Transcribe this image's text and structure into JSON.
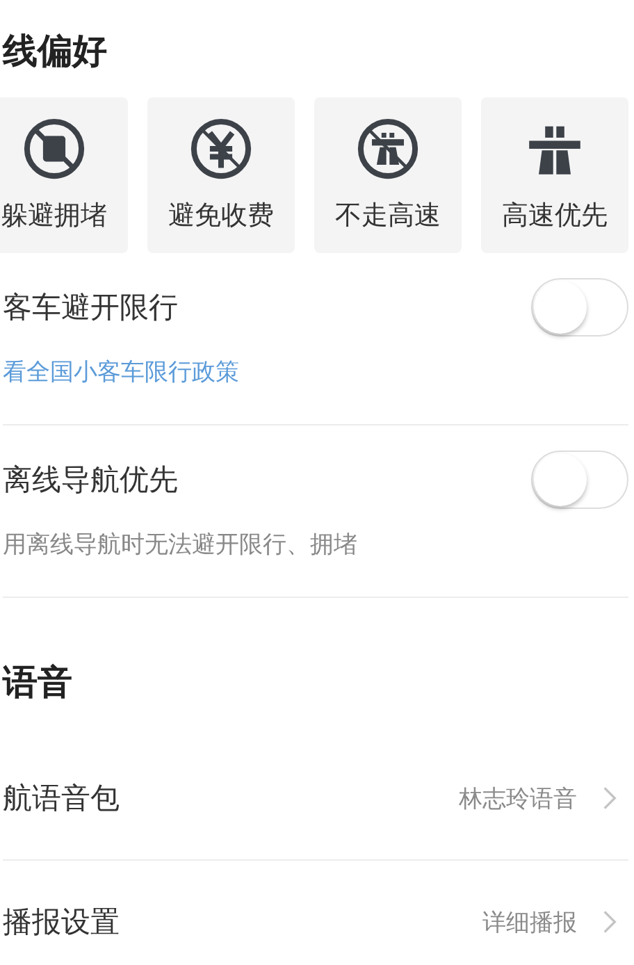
{
  "route_section": {
    "title": "线偏好",
    "options": [
      {
        "label": "躲避拥堵",
        "kind": "jam",
        "selected": false
      },
      {
        "label": "避免收费",
        "kind": "toll",
        "selected": false
      },
      {
        "label": "不走高速",
        "kind": "nohighway",
        "selected": false
      },
      {
        "label": "高速优先",
        "kind": "highway",
        "selected": false
      }
    ],
    "toggles": [
      {
        "label": "客车避开限行",
        "on": false,
        "link": "看全国小客车限行政策"
      },
      {
        "label": "离线导航优先",
        "on": false,
        "note": "用离线导航时无法避开限行、拥堵"
      }
    ]
  },
  "voice_section": {
    "title": "语音",
    "rows": [
      {
        "label": "航语音包",
        "value": "林志玲语音"
      },
      {
        "label": "播报设置",
        "value": "详细播报"
      }
    ]
  }
}
